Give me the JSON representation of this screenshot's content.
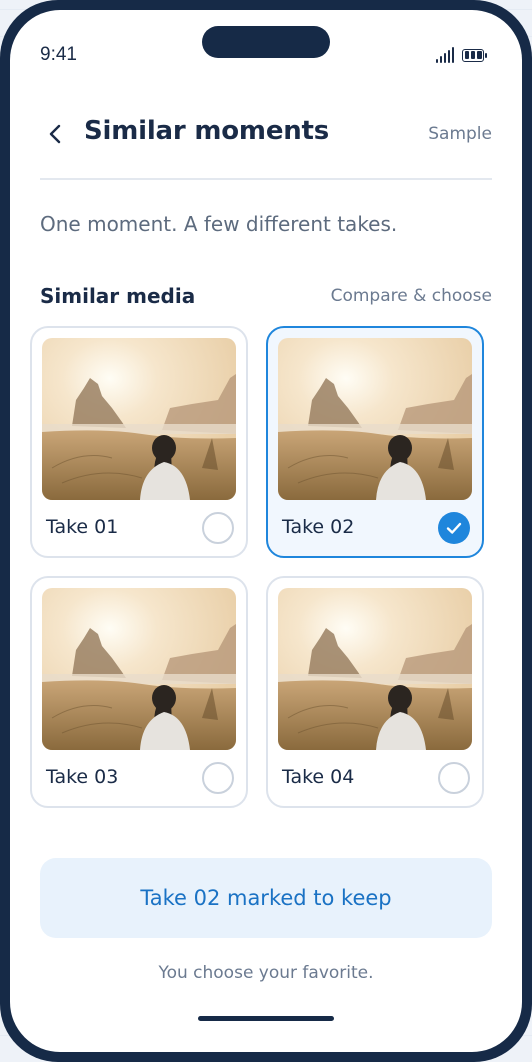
{
  "status_bar": {
    "time": "9:41"
  },
  "header": {
    "title": "Similar moments",
    "action_label": "Sample"
  },
  "subtitle": "One moment. A few different takes.",
  "section": {
    "title": "Similar media",
    "action_label": "Compare & choose"
  },
  "takes": [
    {
      "label": "Take 01",
      "selected": false
    },
    {
      "label": "Take 02",
      "selected": true
    },
    {
      "label": "Take 03",
      "selected": false
    },
    {
      "label": "Take 04",
      "selected": false
    }
  ],
  "keep_banner": {
    "label": "Take 02 marked to keep"
  },
  "footer_note": "You choose your favorite.",
  "colors": {
    "accent": "#1f86dc",
    "frame": "#162a47",
    "text": "#1a2b47",
    "muted": "#6b7a90"
  },
  "icons": {
    "back": "chevron-left-icon",
    "check": "check-icon",
    "signal": "cellular-signal-icon",
    "battery": "battery-icon"
  }
}
